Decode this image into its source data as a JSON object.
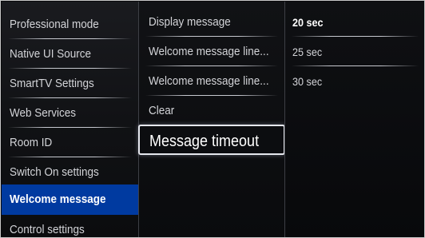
{
  "menu": {
    "level1": [
      {
        "label": "Professional mode"
      },
      {
        "label": "Native UI Source"
      },
      {
        "label": "SmartTV Settings"
      },
      {
        "label": "Web Services"
      },
      {
        "label": "Room ID"
      },
      {
        "label": "Switch On settings"
      },
      {
        "label": "Welcome message",
        "selected": true
      },
      {
        "label": "Control settings"
      }
    ],
    "level2": [
      {
        "label": "Display message"
      },
      {
        "label": "Welcome message line..."
      },
      {
        "label": "Welcome message line..."
      },
      {
        "label": "Clear"
      },
      {
        "label": "Message timeout",
        "focused": true
      }
    ],
    "level3": [
      {
        "label": "20 sec",
        "selected": true
      },
      {
        "label": "25 sec"
      },
      {
        "label": "30 sec"
      }
    ]
  },
  "colors": {
    "selection_blue": "#003aa0",
    "text": "#d3d4d8",
    "highlight_text": "#ffffff"
  }
}
